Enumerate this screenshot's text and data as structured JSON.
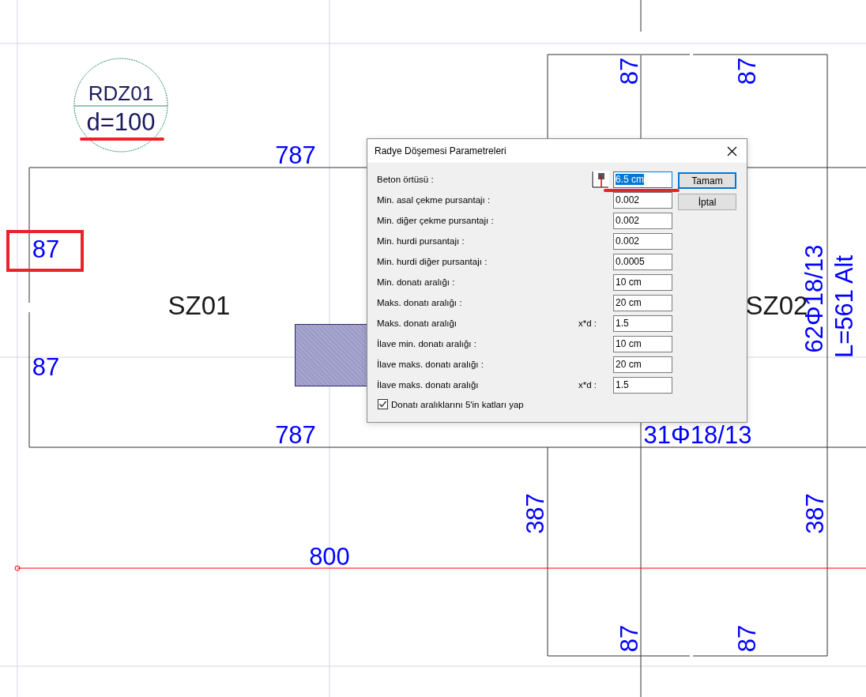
{
  "drawing": {
    "tag": {
      "name": "RDZ01",
      "thickness": "d=100"
    },
    "texts": [
      {
        "text": "787",
        "kind": "dimension",
        "vertical": false
      },
      {
        "text": "87",
        "kind": "dimension",
        "vertical": true
      },
      {
        "text": "87",
        "kind": "dimension",
        "vertical": true
      },
      {
        "text": "87",
        "kind": "dimension",
        "vertical": false
      },
      {
        "text": "SZ01",
        "kind": "slab",
        "vertical": false
      },
      {
        "text": "SZ02",
        "kind": "slab",
        "vertical": false
      },
      {
        "text": "62Φ18/13",
        "kind": "dimension",
        "vertical": true
      },
      {
        "text": "L=561 Alt",
        "kind": "dimension",
        "vertical": true
      },
      {
        "text": "87",
        "kind": "dimension",
        "vertical": false
      },
      {
        "text": "787",
        "kind": "dimension",
        "vertical": false
      },
      {
        "text": "31Φ18/13",
        "kind": "dimension",
        "vertical": false
      },
      {
        "text": "387",
        "kind": "dimension",
        "vertical": true
      },
      {
        "text": "387",
        "kind": "dimension",
        "vertical": true
      },
      {
        "text": "800",
        "kind": "dimension",
        "vertical": false
      },
      {
        "text": "87",
        "kind": "dimension",
        "vertical": true
      },
      {
        "text": "87",
        "kind": "dimension",
        "vertical": true
      }
    ]
  },
  "dialog": {
    "title": "Radye Döşemesi Parametreleri",
    "fields": [
      {
        "label": "Beton örtüsü :",
        "value": "6.5 cm",
        "text_selected": true,
        "kind": "icon"
      },
      {
        "label": "Min. asal çekme pursantajı :",
        "value": "0.002",
        "text_selected": false,
        "kind": "plain"
      },
      {
        "label": "Min. diğer çekme pursantajı :",
        "value": "0.002",
        "text_selected": false,
        "kind": "plain"
      },
      {
        "label": "Min. hurdi pursantajı :",
        "value": "0.002",
        "text_selected": false,
        "kind": "plain"
      },
      {
        "label": "Min. hurdi diğer pursantajı :",
        "value": "0.0005",
        "text_selected": false,
        "kind": "plain"
      },
      {
        "label": "Min. donatı aralığı :",
        "value": "10 cm",
        "text_selected": false,
        "kind": "plain"
      },
      {
        "label": "Maks. donatı aralığı :",
        "value": "20 cm",
        "text_selected": false,
        "kind": "plain"
      },
      {
        "label": "Maks. donatı aralığı",
        "suffix": "x*d :",
        "value": "1.5",
        "text_selected": false,
        "kind": "suffix"
      },
      {
        "label": "İlave min. donatı aralığı :",
        "value": "10 cm",
        "text_selected": false,
        "kind": "plain"
      },
      {
        "label": "İlave maks. donatı aralığı :",
        "value": "20 cm",
        "text_selected": false,
        "kind": "plain"
      },
      {
        "label": "İlave maks. donatı aralığı",
        "suffix": "x*d :",
        "value": "1.5",
        "text_selected": false,
        "kind": "suffix"
      }
    ],
    "buttons": [
      {
        "label": "Tamam",
        "default": true
      },
      {
        "label": "İptal",
        "default": false
      }
    ],
    "checkbox": {
      "label": "Donatı aralıklarını 5'in katları yap",
      "checked": true
    }
  }
}
